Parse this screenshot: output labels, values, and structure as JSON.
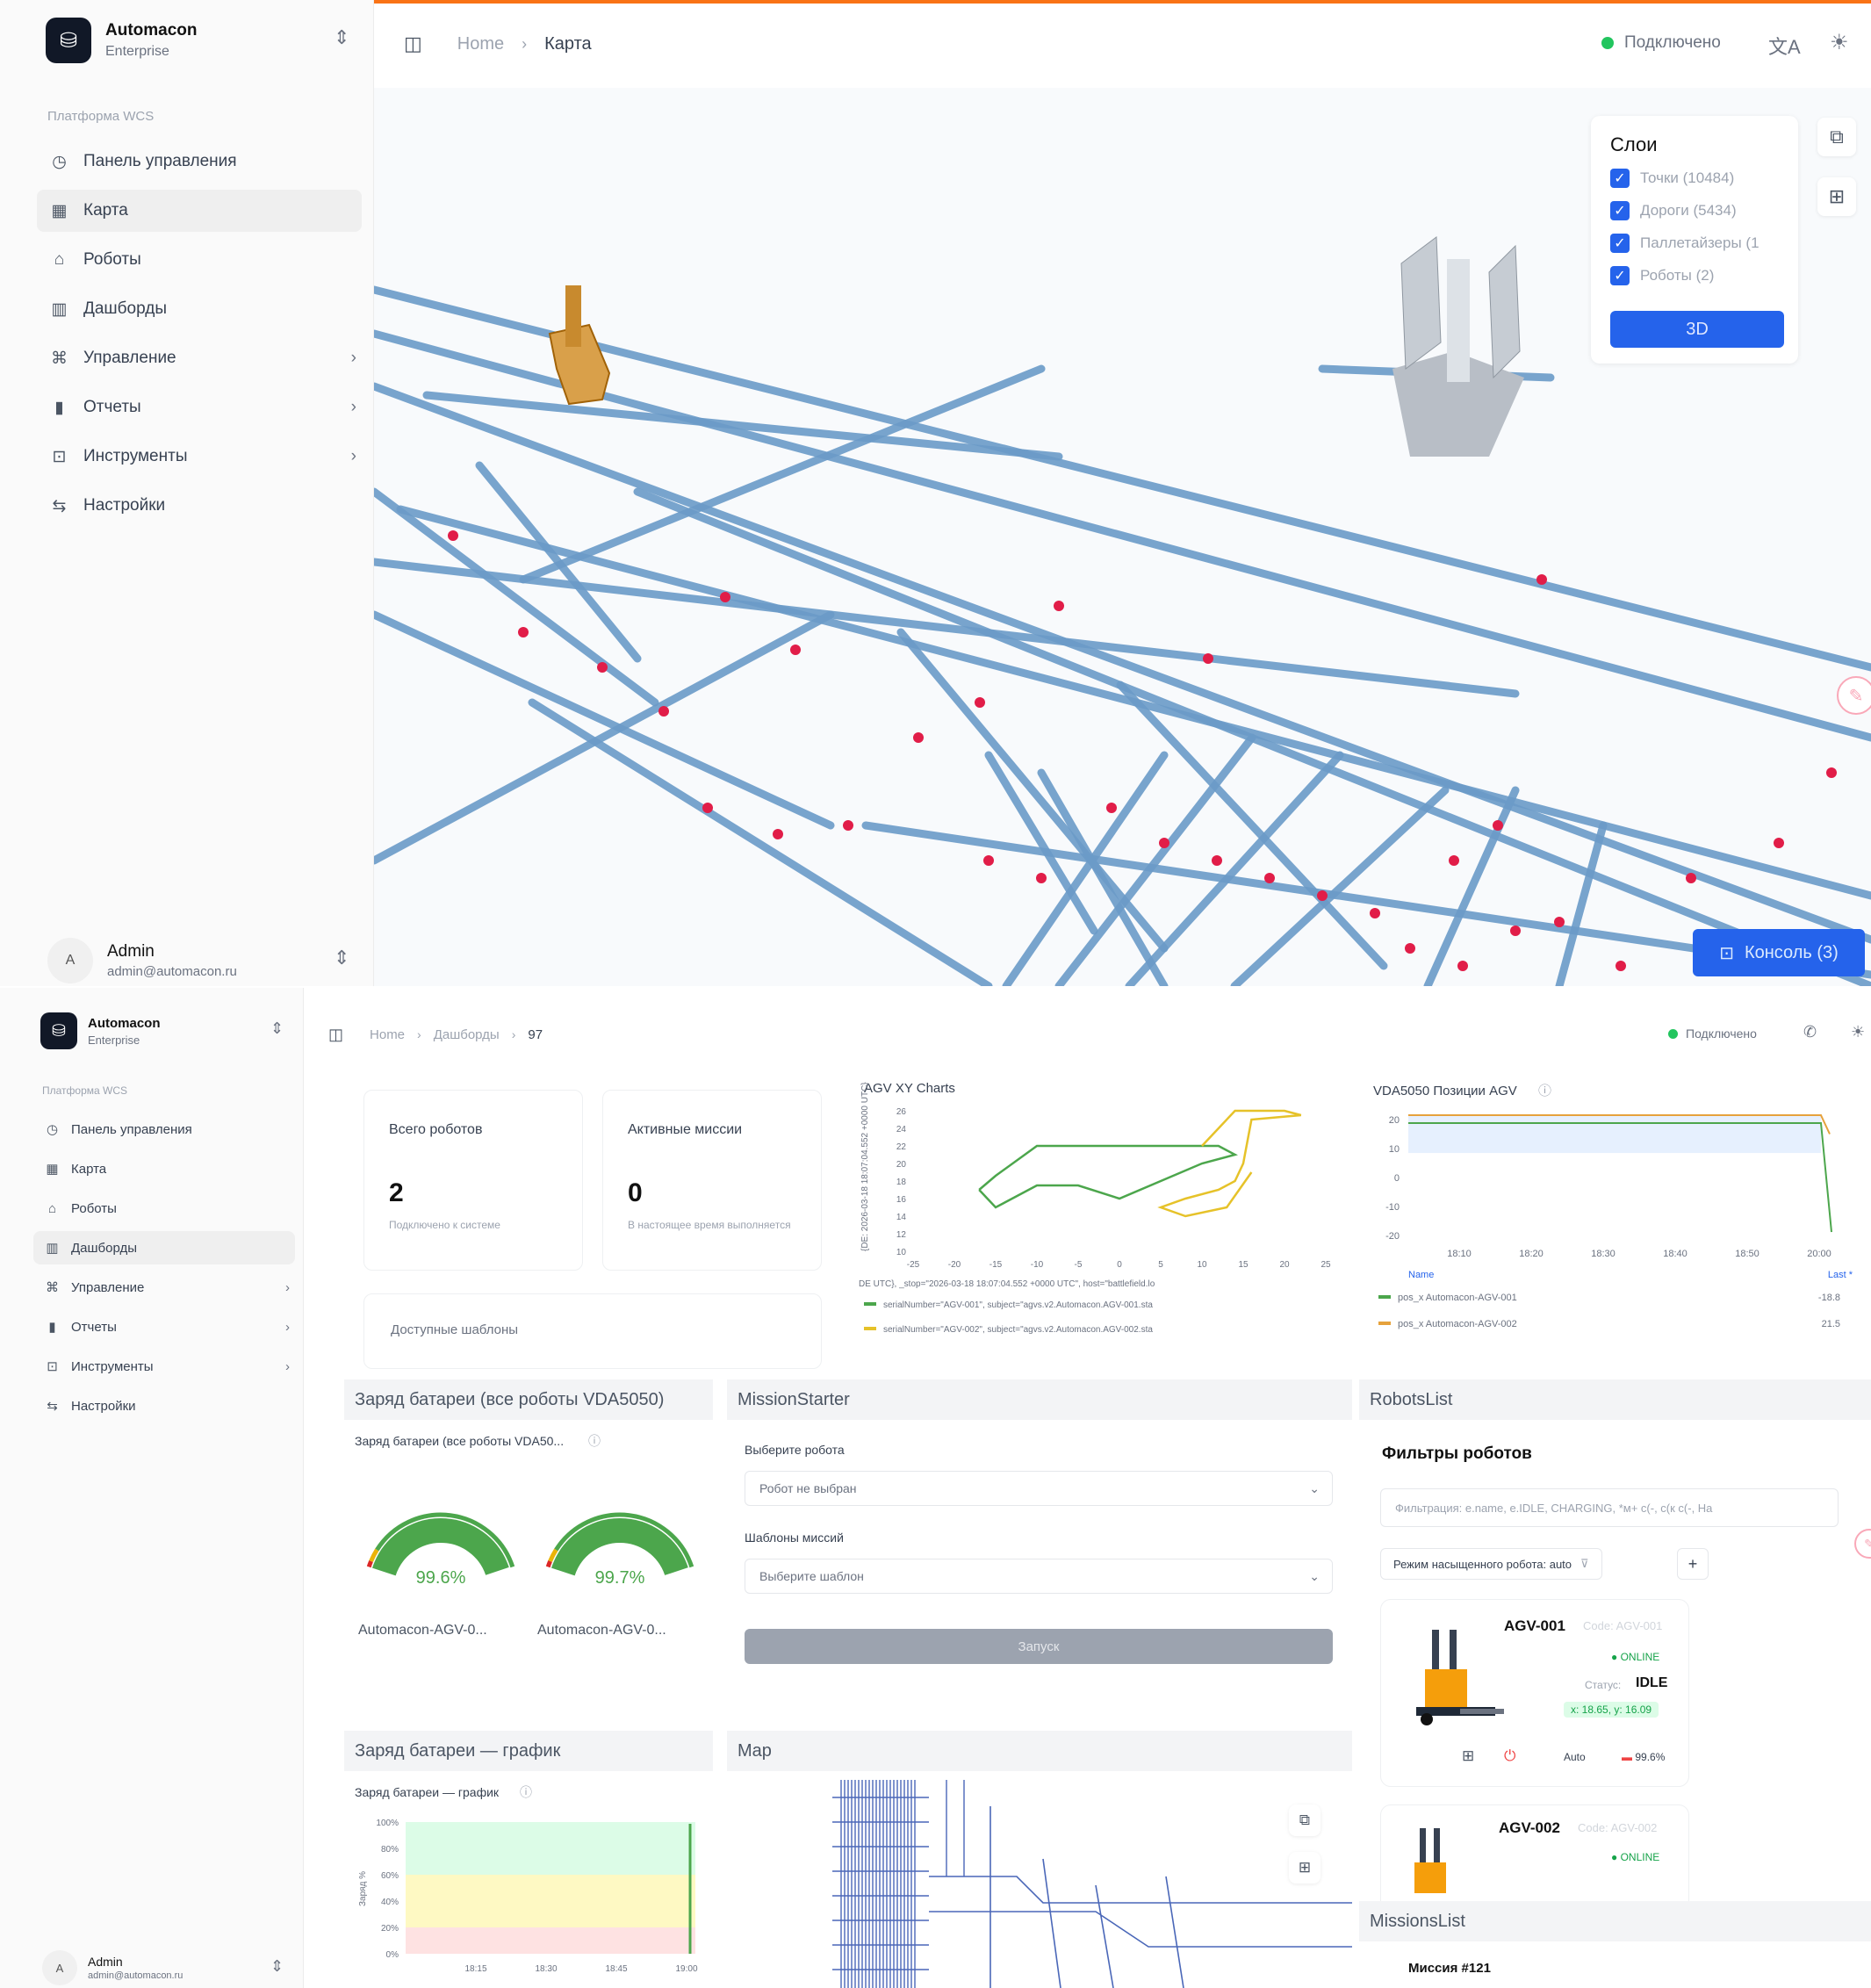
{
  "brand": {
    "name": "Automacon",
    "edition": "Enterprise"
  },
  "sidebar": {
    "group_label": "Платформа WCS",
    "items": [
      {
        "label": "Панель управления",
        "icon": "gauge-icon",
        "chevron": ""
      },
      {
        "label": "Карта",
        "icon": "map-icon",
        "chevron": ""
      },
      {
        "label": "Роботы",
        "icon": "robot-icon",
        "chevron": ""
      },
      {
        "label": "Дашборды",
        "icon": "dashboard-icon",
        "chevron": ""
      },
      {
        "label": "Управление",
        "icon": "command-icon",
        "chevron": "›"
      },
      {
        "label": "Отчеты",
        "icon": "bar-chart-icon",
        "chevron": "›"
      },
      {
        "label": "Инструменты",
        "icon": "tools-icon",
        "chevron": "›"
      },
      {
        "label": "Настройки",
        "icon": "sliders-icon",
        "chevron": ""
      }
    ]
  },
  "user": {
    "initial": "A",
    "name": "Admin",
    "email": "admin@automacon.ru"
  },
  "top": {
    "breadcrumb": [
      "Home",
      "Карта"
    ],
    "connection": "Подключено",
    "layers": {
      "title": "Слои",
      "items": [
        "Точки (10484)",
        "Дороги (5434)",
        "Паллетайзеры (1",
        "Роботы (2)"
      ],
      "button": "3D"
    },
    "console_button": "Консоль (3)"
  },
  "bottom": {
    "breadcrumb": [
      "Home",
      "Дашборды",
      "97"
    ],
    "connection": "Подключено",
    "stats": [
      {
        "label": "Всего роботов",
        "value": "2",
        "sub": "Подключено к системе"
      },
      {
        "label": "Активные миссии",
        "value": "0",
        "sub": "В настоящее время выполняется"
      }
    ],
    "templates_label": "Доступные шаблоны",
    "xy_chart": {
      "title": "AGV XY Charts",
      "ylabel": "{DE: 2026-03-18 18:07:04.552 +0000 UTC}",
      "legend": [
        "serialNumber=\"AGV-001\", subject=\"agvs.v2.Automacon.AGV-001.sta",
        "serialNumber=\"AGV-002\", subject=\"agvs.v2.Automacon.AGV-002.sta"
      ],
      "caption": "DE UTC}, _stop=\"2026-03-18 18:07:04.552 +0000 UTC\", host=\"battlefield.lo"
    },
    "pos_chart": {
      "title": "VDA5050 Позиции AGV",
      "name_header": "Name",
      "last_header": "Last *",
      "legend": [
        {
          "name": "pos_x Automacon-AGV-001",
          "last": "-18.8"
        },
        {
          "name": "pos_x Automacon-AGV-002",
          "last": "21.5"
        }
      ]
    },
    "battery_panel": {
      "title": "Заряд батареи (все роботы VDA5050)",
      "subtitle": "Заряд батареи (все роботы VDA50...",
      "gauges": [
        {
          "label": "Automacon-AGV-0...",
          "value": "99.6%",
          "pct": 99.6
        },
        {
          "label": "Automacon-AGV-0...",
          "value": "99.7%",
          "pct": 99.7
        }
      ]
    },
    "mission_starter": {
      "title": "MissionStarter",
      "robot_label": "Выберите робота",
      "robot_value": "Робот не выбран",
      "template_label": "Шаблоны миссий",
      "template_value": "Выберите шаблон",
      "start_button": "Запуск"
    },
    "robots_list": {
      "title": "RobotsList",
      "filters_title": "Фильтры роботов",
      "search_placeholder": "Фильтрация: e.name, e.IDLE, CHARGING, *м+ c(-, c(к c(-, На",
      "mode_filter": "Режим насыщенного робота: auto",
      "add": "+",
      "robots": [
        {
          "name": "AGV-001",
          "code": "Code: AGV-001",
          "status": "ONLINE",
          "state_label": "Статус:",
          "state": "IDLE",
          "coords": "x: 18.65, y: 16.09",
          "mode": "Auto",
          "battery": "99.6%"
        },
        {
          "name": "AGV-002",
          "code": "Code: AGV-002",
          "status": "ONLINE"
        }
      ]
    },
    "battery_chart": {
      "title": "Заряд батареи — график",
      "subtitle": "Заряд батареи — график",
      "ylabel": "Заряд %",
      "yticks": [
        "100%",
        "80%",
        "60%",
        "40%",
        "20%",
        "0%"
      ],
      "xticks": [
        "18:15",
        "18:30",
        "18:45",
        "19:00"
      ]
    },
    "map_panel": {
      "title": "Map"
    },
    "missions_list": {
      "title": "MissionsList",
      "first": "Миссия #121"
    }
  }
}
